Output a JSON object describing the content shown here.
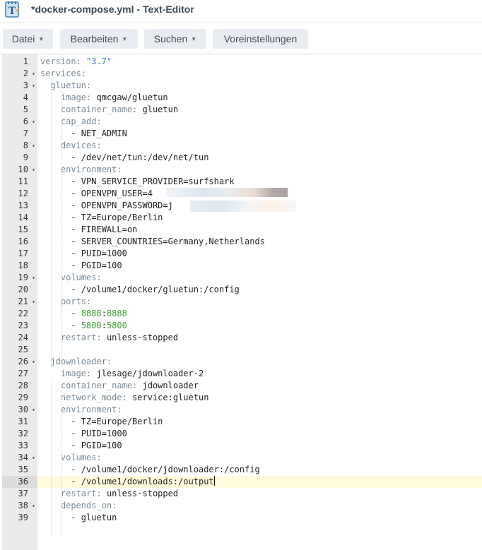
{
  "window": {
    "title": "*docker-compose.yml - Text-Editor",
    "icon": "text-editor-icon"
  },
  "toolbar": [
    {
      "label": "Datei",
      "dropdown": true
    },
    {
      "label": "Bearbeiten",
      "dropdown": true
    },
    {
      "label": "Suchen",
      "dropdown": true
    },
    {
      "label": "Voreinstellungen",
      "dropdown": false
    }
  ],
  "editor": {
    "active_line": 36,
    "lines": [
      {
        "n": "1",
        "fold": false,
        "indent": "",
        "parts": [
          {
            "t": "k",
            "v": "version: "
          },
          {
            "t": "s",
            "v": "\"3.7\""
          }
        ]
      },
      {
        "n": "2",
        "fold": true,
        "indent": "",
        "parts": [
          {
            "t": "k",
            "v": "services:"
          }
        ]
      },
      {
        "n": "3",
        "fold": true,
        "indent": "  ",
        "parts": [
          {
            "t": "k",
            "v": "gluetun:"
          }
        ]
      },
      {
        "n": "4",
        "fold": false,
        "indent": "    ",
        "parts": [
          {
            "t": "k",
            "v": "image: "
          },
          {
            "t": "v",
            "v": "qmcgaw/gluetun"
          }
        ]
      },
      {
        "n": "5",
        "fold": false,
        "indent": "    ",
        "parts": [
          {
            "t": "k",
            "v": "container_name: "
          },
          {
            "t": "v",
            "v": "gluetun"
          }
        ]
      },
      {
        "n": "6",
        "fold": true,
        "indent": "    ",
        "parts": [
          {
            "t": "k",
            "v": "cap_add:"
          }
        ]
      },
      {
        "n": "7",
        "fold": false,
        "indent": "      ",
        "parts": [
          {
            "t": "v",
            "v": "- NET_ADMIN"
          }
        ]
      },
      {
        "n": "8",
        "fold": true,
        "indent": "    ",
        "parts": [
          {
            "t": "k",
            "v": "devices:"
          }
        ]
      },
      {
        "n": "9",
        "fold": false,
        "indent": "      ",
        "parts": [
          {
            "t": "v",
            "v": "- /dev/net/tun:/dev/net/tun"
          }
        ]
      },
      {
        "n": "10",
        "fold": true,
        "indent": "    ",
        "parts": [
          {
            "t": "k",
            "v": "environment:"
          }
        ]
      },
      {
        "n": "11",
        "fold": false,
        "indent": "      ",
        "parts": [
          {
            "t": "v",
            "v": "- VPN_SERVICE_PROVIDER=surfshark"
          }
        ]
      },
      {
        "n": "12",
        "fold": false,
        "indent": "      ",
        "parts": [
          {
            "t": "v",
            "v": "- OPENVPN_USER=4"
          }
        ]
      },
      {
        "n": "13",
        "fold": false,
        "indent": "      ",
        "parts": [
          {
            "t": "v",
            "v": "- OPENVPN_PASSWORD=j"
          }
        ]
      },
      {
        "n": "14",
        "fold": false,
        "indent": "      ",
        "parts": [
          {
            "t": "v",
            "v": "- TZ=Europe/Berlin"
          }
        ]
      },
      {
        "n": "15",
        "fold": false,
        "indent": "      ",
        "parts": [
          {
            "t": "v",
            "v": "- FIREWALL=on"
          }
        ]
      },
      {
        "n": "16",
        "fold": false,
        "indent": "      ",
        "parts": [
          {
            "t": "v",
            "v": "- SERVER_COUNTRIES=Germany,Netherlands"
          }
        ]
      },
      {
        "n": "17",
        "fold": false,
        "indent": "      ",
        "parts": [
          {
            "t": "v",
            "v": "- PUID=1000"
          }
        ]
      },
      {
        "n": "18",
        "fold": false,
        "indent": "      ",
        "parts": [
          {
            "t": "v",
            "v": "- PGID=100"
          }
        ]
      },
      {
        "n": "19",
        "fold": true,
        "indent": "    ",
        "parts": [
          {
            "t": "k",
            "v": "volumes:"
          }
        ]
      },
      {
        "n": "20",
        "fold": false,
        "indent": "      ",
        "parts": [
          {
            "t": "v",
            "v": "- /volume1/docker/gluetun:/config"
          }
        ]
      },
      {
        "n": "21",
        "fold": true,
        "indent": "    ",
        "parts": [
          {
            "t": "k",
            "v": "ports:"
          }
        ]
      },
      {
        "n": "22",
        "fold": false,
        "indent": "      ",
        "parts": [
          {
            "t": "v",
            "v": "- "
          },
          {
            "t": "n",
            "v": "8888"
          },
          {
            "t": "v",
            "v": ":"
          },
          {
            "t": "n",
            "v": "8888"
          }
        ]
      },
      {
        "n": "23",
        "fold": false,
        "indent": "      ",
        "parts": [
          {
            "t": "v",
            "v": "- "
          },
          {
            "t": "n",
            "v": "5800"
          },
          {
            "t": "v",
            "v": ":"
          },
          {
            "t": "n",
            "v": "5800"
          }
        ]
      },
      {
        "n": "24",
        "fold": false,
        "indent": "    ",
        "parts": [
          {
            "t": "k",
            "v": "restart: "
          },
          {
            "t": "v",
            "v": "unless-stopped"
          }
        ]
      },
      {
        "n": "25",
        "fold": false,
        "indent": "",
        "parts": []
      },
      {
        "n": "26",
        "fold": true,
        "indent": "  ",
        "parts": [
          {
            "t": "k",
            "v": "jdownloader:"
          }
        ]
      },
      {
        "n": "27",
        "fold": false,
        "indent": "    ",
        "parts": [
          {
            "t": "k",
            "v": "image: "
          },
          {
            "t": "v",
            "v": "jlesage/jdownloader-2"
          }
        ]
      },
      {
        "n": "28",
        "fold": false,
        "indent": "    ",
        "parts": [
          {
            "t": "k",
            "v": "container_name: "
          },
          {
            "t": "v",
            "v": "jdownloader"
          }
        ]
      },
      {
        "n": "29",
        "fold": false,
        "indent": "    ",
        "parts": [
          {
            "t": "k",
            "v": "network_mode: "
          },
          {
            "t": "v",
            "v": "service:gluetun"
          }
        ]
      },
      {
        "n": "30",
        "fold": true,
        "indent": "    ",
        "parts": [
          {
            "t": "k",
            "v": "environment:"
          }
        ]
      },
      {
        "n": "31",
        "fold": false,
        "indent": "      ",
        "parts": [
          {
            "t": "v",
            "v": "- TZ=Europe/Berlin"
          }
        ]
      },
      {
        "n": "32",
        "fold": false,
        "indent": "      ",
        "parts": [
          {
            "t": "v",
            "v": "- PUID=1000"
          }
        ]
      },
      {
        "n": "33",
        "fold": false,
        "indent": "      ",
        "parts": [
          {
            "t": "v",
            "v": "- PGID=100"
          }
        ]
      },
      {
        "n": "34",
        "fold": true,
        "indent": "    ",
        "parts": [
          {
            "t": "k",
            "v": "volumes:"
          }
        ]
      },
      {
        "n": "35",
        "fold": false,
        "indent": "      ",
        "parts": [
          {
            "t": "v",
            "v": "- /volume1/docker/jdownloader:/config"
          }
        ]
      },
      {
        "n": "36",
        "fold": false,
        "indent": "      ",
        "parts": [
          {
            "t": "v",
            "v": "- /volume1/downloads:/output"
          }
        ]
      },
      {
        "n": "37",
        "fold": false,
        "indent": "    ",
        "parts": [
          {
            "t": "k",
            "v": "restart: "
          },
          {
            "t": "v",
            "v": "unless-stopped"
          }
        ]
      },
      {
        "n": "38",
        "fold": true,
        "indent": "    ",
        "parts": [
          {
            "t": "k",
            "v": "depends_on:"
          }
        ]
      },
      {
        "n": "39",
        "fold": false,
        "indent": "      ",
        "parts": [
          {
            "t": "v",
            "v": "- gluetun"
          }
        ]
      }
    ]
  }
}
